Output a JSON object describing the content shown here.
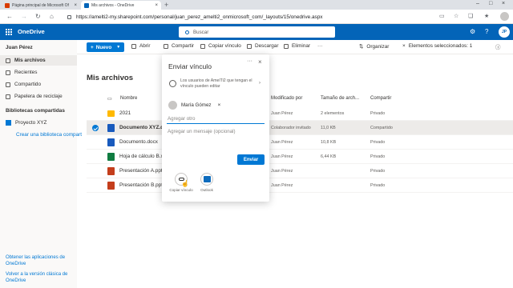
{
  "browser": {
    "tabs": [
      {
        "title": "Página principal de Microsoft Of",
        "favicon_color": "#d83b01"
      },
      {
        "title": "Mis archivos - OneDrive",
        "favicon_color": "#0364b8"
      }
    ],
    "new_tab": "+",
    "url": "https://amelti2-my.sharepoint.com/personal/juan_perez_amelti2_onmicrosoft_com/_layouts/15/onedrive.aspx"
  },
  "header": {
    "brand": "OneDrive",
    "search_placeholder": "Buscar",
    "avatar_initials": "JP"
  },
  "leftnav": {
    "user": "Juan Pérez",
    "items": [
      {
        "label": "Mis archivos",
        "selected": true
      },
      {
        "label": "Recientes",
        "selected": false
      },
      {
        "label": "Compartido",
        "selected": false
      },
      {
        "label": "Papelera de reciclaje",
        "selected": false
      }
    ],
    "libraries_header": "Bibliotecas compartidas",
    "library": "Proyecto XYZ",
    "create_library": "Crear una biblioteca compart",
    "footer_apps": "Obtener las aplicaciones de OneDrive",
    "footer_classic": "Volver a la versión clásica de OneDrive"
  },
  "commandbar": {
    "new": "Nuevo",
    "open": "Abrir",
    "share": "Compartir",
    "copy_link": "Copiar vínculo",
    "download": "Descargar",
    "delete": "Eliminar",
    "more": "···",
    "sort": "Organizar",
    "selected": "Elementos seleccionados: 1"
  },
  "main": {
    "title": "Mis archivos",
    "columns": {
      "name": "Nombre",
      "modified_by": "Modificado por",
      "size": "Tamaño de arch...",
      "sharing": "Compartir"
    },
    "rows": [
      {
        "name": "2021",
        "type": "folder",
        "modified_by": "Juan Pérez",
        "size": "2 elementos",
        "sharing": "Privado",
        "selected": false
      },
      {
        "name": "Documento XYZ.docx",
        "type": "word",
        "modified_by": "Colaborador invitado",
        "size": "11,0 KB",
        "sharing": "Compartido",
        "selected": true
      },
      {
        "name": "Documento.docx",
        "type": "word",
        "modified_by": "Juan Pérez",
        "size": "10,8 KB",
        "sharing": "Privado",
        "selected": false
      },
      {
        "name": "Hoja de cálculo B.xlsx",
        "type": "excel",
        "modified_by": "Juan Pérez",
        "size": "6,44 KB",
        "sharing": "Privado",
        "selected": false
      },
      {
        "name": "Presentación A.pptx",
        "type": "ppt",
        "modified_by": "Juan Pérez",
        "size": "",
        "sharing": "Privado",
        "selected": false
      },
      {
        "name": "Presentación B.pptx",
        "type": "ppt",
        "modified_by": "Juan Pérez",
        "size": "",
        "sharing": "Privado",
        "selected": false
      }
    ]
  },
  "dialog": {
    "title": "Enviar vínculo",
    "permission": "Los usuarios de AmelTi2 que tengan el vínculo pueden editar",
    "recipient": "María Gómez",
    "add_placeholder": "Agregar otro",
    "message_placeholder": "Agregar un mensaje (opcional)",
    "send": "Enviar",
    "copy_link": "Copiar vínculo",
    "outlook": "Outlook"
  }
}
